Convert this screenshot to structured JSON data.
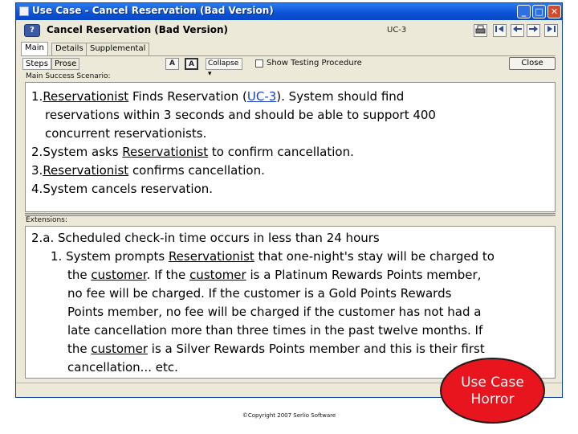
{
  "window": {
    "title": "Use Case - Cancel Reservation (Bad Version)",
    "buttons": {
      "minimize": "_",
      "maximize": "□",
      "close": "✕"
    }
  },
  "header": {
    "help_glyph": "?",
    "title": "Cancel Reservation (Bad Version)",
    "id": "UC-3",
    "tools": [
      "print-icon",
      "first-icon",
      "back-icon",
      "forward-icon",
      "last-icon"
    ]
  },
  "tabs": [
    "Main",
    "Details",
    "Supplemental"
  ],
  "active_tab": "Main",
  "subbar": {
    "view_tabs": [
      "Steps",
      "Prose"
    ],
    "format_glyph_1": "A",
    "format_glyph_2": "A",
    "collapse_label": "Collapse",
    "show_testing_label": "Show Testing Procedure",
    "close_label": "Close"
  },
  "main_scenario": {
    "label": "Main Success Scenario:",
    "steps": [
      {
        "num": "1.",
        "actor": "Reservationist",
        "text_a": " Finds Reservation (",
        "link": "UC-3",
        "text_b": "). System should find",
        "cont": [
          "reservations within 3 seconds and should be able to support 400",
          "concurrent reservationists."
        ]
      },
      {
        "num": "2.",
        "pre": "System asks ",
        "actor": "Reservationist",
        "text": " to confirm cancellation."
      },
      {
        "num": "3.",
        "actor": "Reservationist",
        "text": " confirms cancellation."
      },
      {
        "num": "4.",
        "text": "System cancels reservation."
      }
    ]
  },
  "extensions": {
    "label": "Extensions:",
    "head": "2.a. Scheduled check-in time occurs in less than 24 hours",
    "step": {
      "num": "1.",
      "pre": "System prompts ",
      "actor": "Reservationist",
      "post": " that one-night's stay will be charged to",
      "line2_pre": "the ",
      "customer_1": "customer",
      "line2_mid": ". If the ",
      "customer_2": "customer",
      "line2_post": " is a Platinum Rewards Points member,",
      "line3": "no fee will be charged. If the customer is a Gold Points Rewards",
      "line4": "Points member, no fee will be charged if the customer has not had a",
      "line5": "late cancellation more than three times in the past twelve months. If",
      "line6_pre": "the ",
      "customer_3": "customer",
      "line6_post": " is a Silver Rewards Points member and this is their first",
      "line7": "cancellation... etc."
    }
  },
  "footer": {
    "copyright": "©Copyright 2007 Serlio Software"
  },
  "badge": {
    "line1": "Use Case",
    "line2": "Horror"
  },
  "colors": {
    "titlebar": "#0b52d6",
    "link": "#1a3fc7",
    "badge": "#e8141e"
  }
}
